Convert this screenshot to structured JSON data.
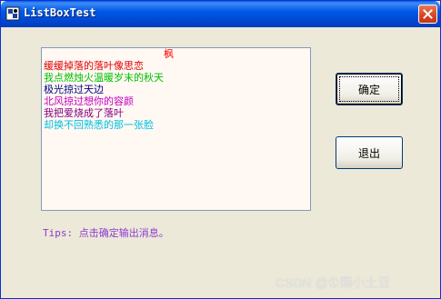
{
  "window": {
    "title": "ListBoxTest"
  },
  "listbox": {
    "items": [
      {
        "text": "枫",
        "color": "#ff0000",
        "align": "right"
      },
      {
        "text": "缓缓掉落的落叶像思恋",
        "color": "#e00000",
        "align": "left"
      },
      {
        "text": "我点燃烛火温暖岁末的秋天",
        "color": "#00c000",
        "align": "left"
      },
      {
        "text": "极光掠过天边",
        "color": "#000080",
        "align": "left"
      },
      {
        "text": "北风掠过想你的容颜",
        "color": "#c000c0",
        "align": "left"
      },
      {
        "text": "我把爱烧成了落叶",
        "color": "#800080",
        "align": "left"
      },
      {
        "text": "却换不回熟悉的那一张脸",
        "color": "#00c0e0",
        "align": "left"
      }
    ]
  },
  "buttons": {
    "ok_label": "确定",
    "exit_label": "退出"
  },
  "tips": "Tips: 点击确定输出消息。",
  "watermark": "CSDN @①颗小土豆"
}
